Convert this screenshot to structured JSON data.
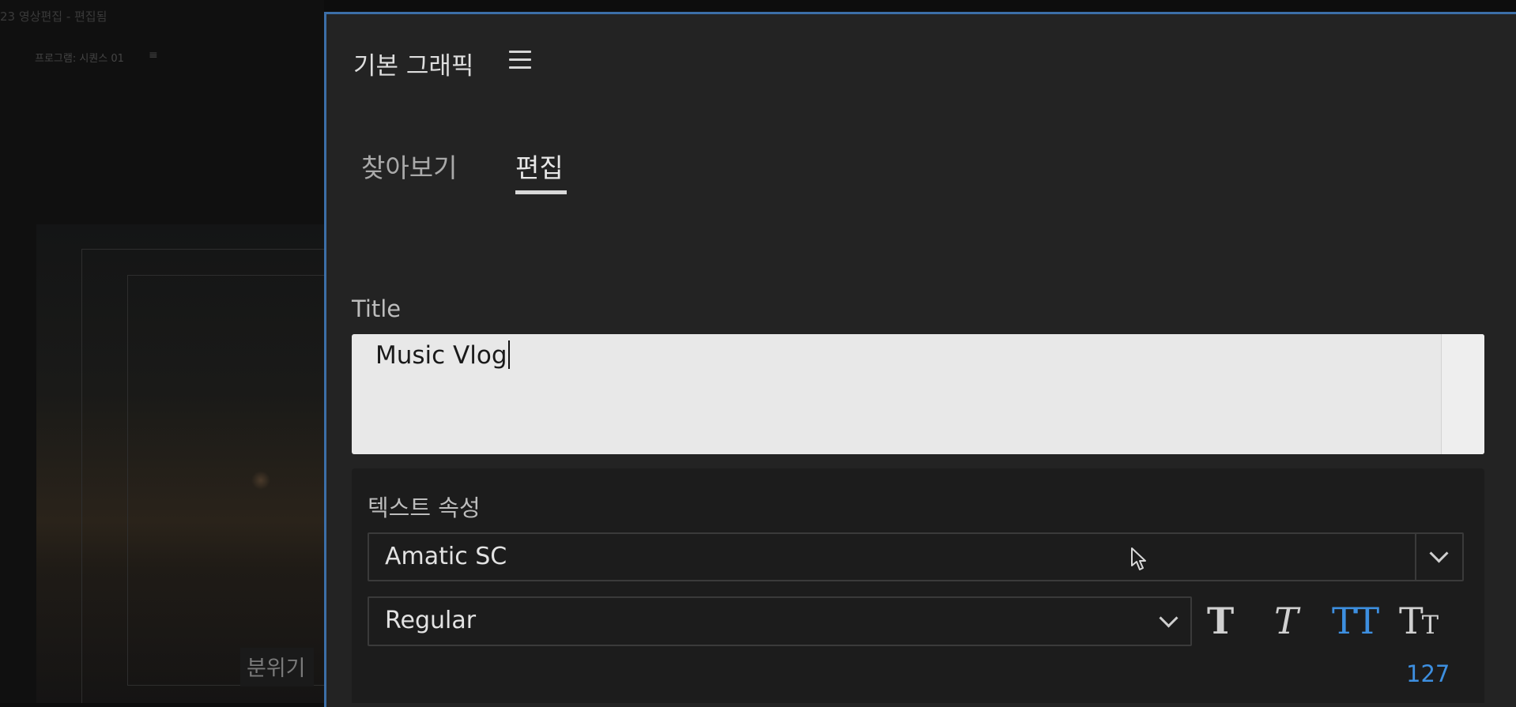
{
  "window": {
    "project_title": "23 영상편집 - 편집됨"
  },
  "program_monitor": {
    "label": "프로그램: 시퀀스 01",
    "menu_icon": "hamburger-icon",
    "caption": "분위기"
  },
  "panel": {
    "title": "기본 그래픽",
    "menu_icon": "hamburger-icon",
    "tabs": [
      {
        "label": "찾아보기",
        "active": false
      },
      {
        "label": "편집",
        "active": true
      }
    ],
    "accent_color": "#3c6fa8"
  },
  "title_field": {
    "label": "Title",
    "value": "Music Vlog"
  },
  "text_properties": {
    "section_title": "텍스트 속성",
    "font": "Amatic SC",
    "font_style": "Regular",
    "format_buttons": [
      {
        "name": "faux-bold",
        "glyph": "T",
        "active": false
      },
      {
        "name": "faux-italic",
        "glyph": "T",
        "active": false
      },
      {
        "name": "all-caps",
        "glyph": "TT",
        "active": true
      },
      {
        "name": "small-caps",
        "glyph": "Tт",
        "active": false
      }
    ],
    "font_size": "127",
    "active_color": "#3d8fe0"
  }
}
